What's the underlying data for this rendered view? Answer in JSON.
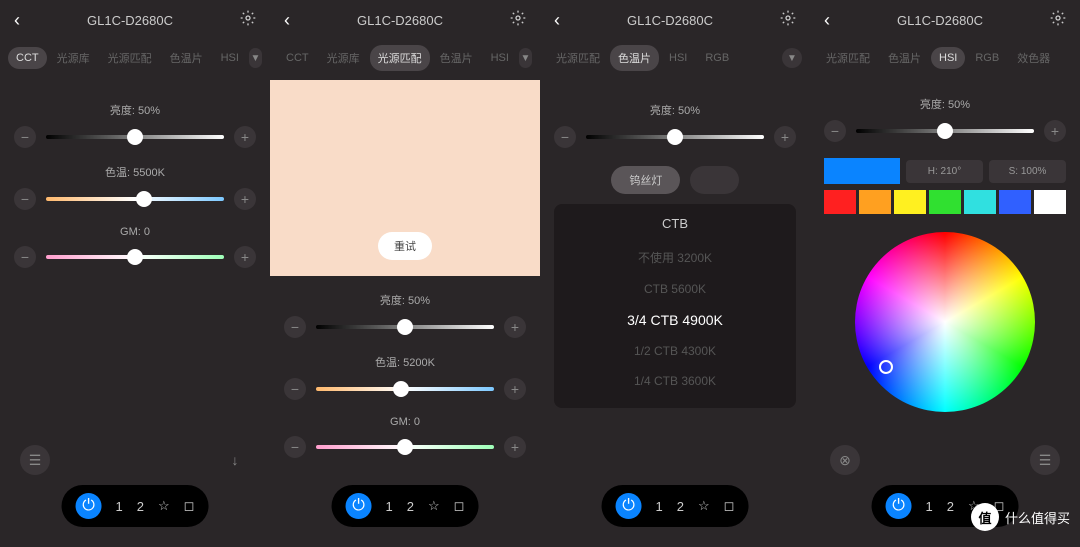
{
  "device": "GL1C-D2680C",
  "panels": [
    {
      "tabs": [
        "CCT",
        "光源库",
        "光源匹配",
        "色温片",
        "HSI"
      ],
      "activeTab": 0,
      "sliders": [
        {
          "label": "亮度: 50%",
          "pos": 50,
          "track": "bright"
        },
        {
          "label": "色温: 5500K",
          "pos": 55,
          "track": "temp"
        },
        {
          "label": "GM: 0",
          "pos": 50,
          "track": "gm"
        }
      ]
    },
    {
      "tabs": [
        "CCT",
        "光源库",
        "光源匹配",
        "色温片",
        "HSI"
      ],
      "activeTab": 2,
      "retry": "重试",
      "sliders": [
        {
          "label": "亮度: 50%",
          "pos": 50,
          "track": "bright"
        },
        {
          "label": "色温: 5200K",
          "pos": 48,
          "track": "temp"
        },
        {
          "label": "GM: 0",
          "pos": 50,
          "track": "gm"
        }
      ]
    },
    {
      "tabs": [
        "光源匹配",
        "色温片",
        "HSI",
        "RGB"
      ],
      "activeTab": 1,
      "sliders": [
        {
          "label": "亮度: 50%",
          "pos": 50,
          "track": "bright"
        }
      ],
      "pills": [
        "钨丝灯",
        ""
      ],
      "picker": {
        "title": "CTB",
        "items": [
          "不使用 3200K",
          "CTB 5600K",
          "3/4 CTB 4900K",
          "1/2 CTB 4300K",
          "1/4 CTB 3600K"
        ],
        "sel": 2
      }
    },
    {
      "tabs": [
        "光源匹配",
        "色温片",
        "HSI",
        "RGB",
        "效色器"
      ],
      "activeTab": 2,
      "sliders": [
        {
          "label": "亮度: 50%",
          "pos": 50,
          "track": "bright"
        }
      ],
      "hs": {
        "h": "H: 210°",
        "s": "S: 100%"
      },
      "swatches": [
        "#ff2020",
        "#ffa020",
        "#fff020",
        "#30e030",
        "#30e0e0",
        "#3060ff",
        "#ffffff"
      ]
    }
  ],
  "bottom": {
    "nums": [
      "1",
      "2"
    ]
  },
  "watermark": "什么值得买"
}
